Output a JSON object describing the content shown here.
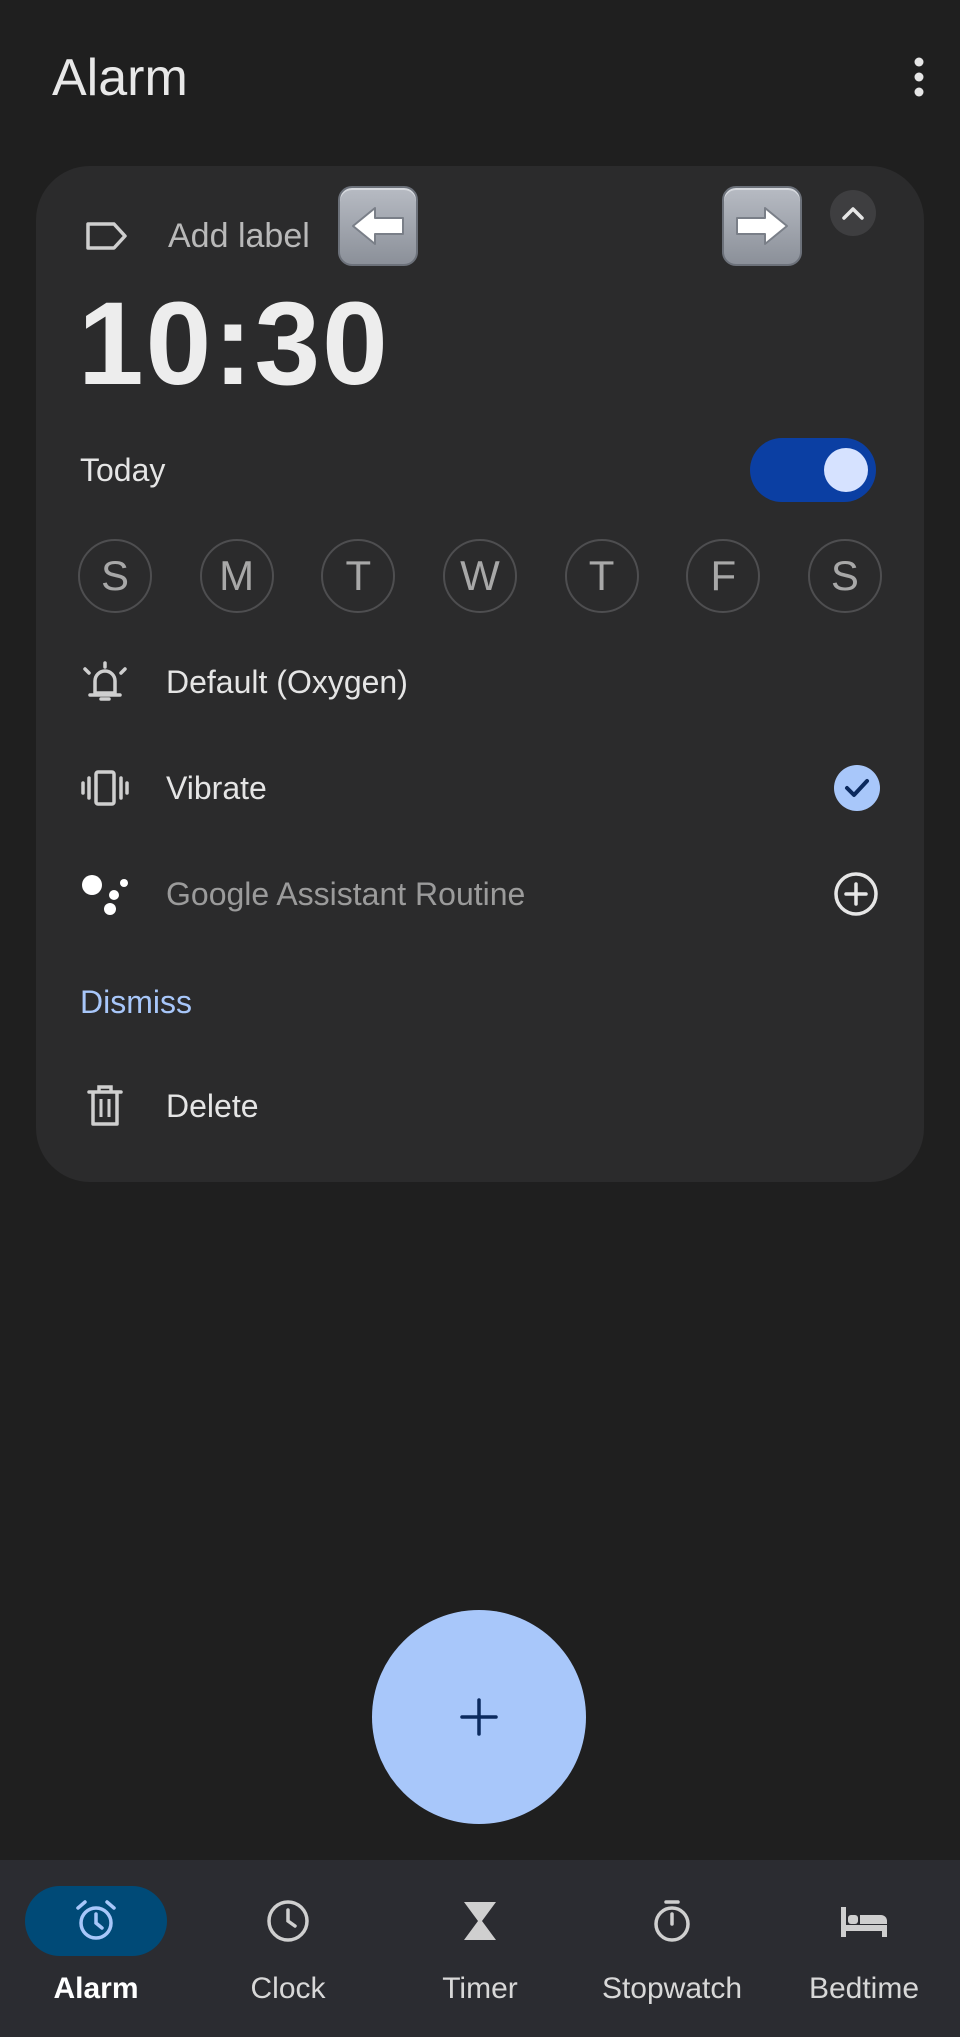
{
  "app_bar": {
    "title": "Alarm",
    "more_icon": "more-vert-icon"
  },
  "alarm": {
    "label_placeholder": "Add label",
    "time": "10:30",
    "schedule": "Today",
    "enabled": true,
    "days": [
      "S",
      "M",
      "T",
      "W",
      "T",
      "F",
      "S"
    ],
    "ringtone": "Default (Oxygen)",
    "vibrate_label": "Vibrate",
    "vibrate_checked": true,
    "routine_label": "Google Assistant Routine",
    "dismiss_label": "Dismiss",
    "delete_label": "Delete"
  },
  "fab": {
    "icon": "plus-icon",
    "label": "+"
  },
  "bottom_nav": {
    "items": [
      {
        "label": "Alarm",
        "icon": "alarm-icon",
        "active": true
      },
      {
        "label": "Clock",
        "icon": "clock-icon",
        "active": false
      },
      {
        "label": "Timer",
        "icon": "hourglass-icon",
        "active": false
      },
      {
        "label": "Stopwatch",
        "icon": "stopwatch-icon",
        "active": false
      },
      {
        "label": "Bedtime",
        "icon": "bed-icon",
        "active": false
      }
    ]
  },
  "colors": {
    "background": "#1f1f1f",
    "card": "#2b2b2c",
    "accent": "#a8c7fa",
    "toggle_track": "#0b3fa3",
    "nav_active": "#004a77"
  }
}
